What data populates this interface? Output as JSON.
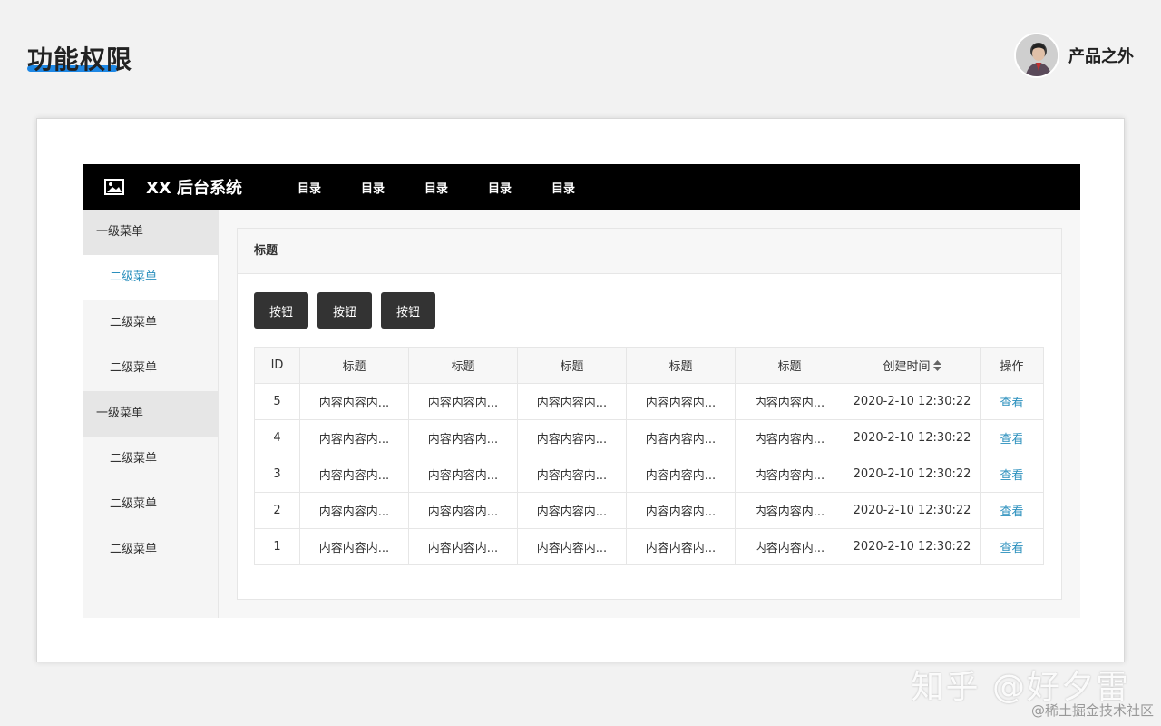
{
  "slide": {
    "title": "功能权限",
    "author": "产品之外",
    "accent_color": "#1e88e5"
  },
  "app": {
    "brand": "XX 后台系统",
    "logo_icon": "image-icon",
    "nav": [
      "目录",
      "目录",
      "目录",
      "目录",
      "目录"
    ],
    "sidebar": [
      {
        "label": "一级菜单",
        "children": [
          "二级菜单",
          "二级菜单",
          "二级菜单"
        ],
        "active_child": 0
      },
      {
        "label": "一级菜单",
        "children": [
          "二级菜单",
          "二级菜单",
          "二级菜单"
        ],
        "active_child": -1
      }
    ],
    "panel_title": "标题",
    "buttons": [
      "按钮",
      "按钮",
      "按钮"
    ],
    "table": {
      "columns": [
        "ID",
        "标题",
        "标题",
        "标题",
        "标题",
        "标题",
        "创建时间",
        "操作"
      ],
      "sortable_column": "创建时间",
      "sort_icon": "sort-icon",
      "rows": [
        {
          "id": "5",
          "cells": [
            "内容内容内...",
            "内容内容内...",
            "内容内容内...",
            "内容内容内...",
            "内容内容内..."
          ],
          "created": "2020-2-10 12:30:22",
          "action": "查看"
        },
        {
          "id": "4",
          "cells": [
            "内容内容内...",
            "内容内容内...",
            "内容内容内...",
            "内容内容内...",
            "内容内容内..."
          ],
          "created": "2020-2-10 12:30:22",
          "action": "查看"
        },
        {
          "id": "3",
          "cells": [
            "内容内容内...",
            "内容内容内...",
            "内容内容内...",
            "内容内容内...",
            "内容内容内..."
          ],
          "created": "2020-2-10 12:30:22",
          "action": "查看"
        },
        {
          "id": "2",
          "cells": [
            "内容内容内...",
            "内容内容内...",
            "内容内容内...",
            "内容内容内...",
            "内容内容内..."
          ],
          "created": "2020-2-10 12:30:22",
          "action": "查看"
        },
        {
          "id": "1",
          "cells": [
            "内容内容内...",
            "内容内容内...",
            "内容内容内...",
            "内容内容内...",
            "内容内容内..."
          ],
          "created": "2020-2-10 12:30:22",
          "action": "查看"
        }
      ]
    },
    "link_color": "#2a8fbd"
  },
  "watermark": {
    "line1": "知乎 @好夕雷",
    "line2": "@稀土掘金技术社区"
  }
}
